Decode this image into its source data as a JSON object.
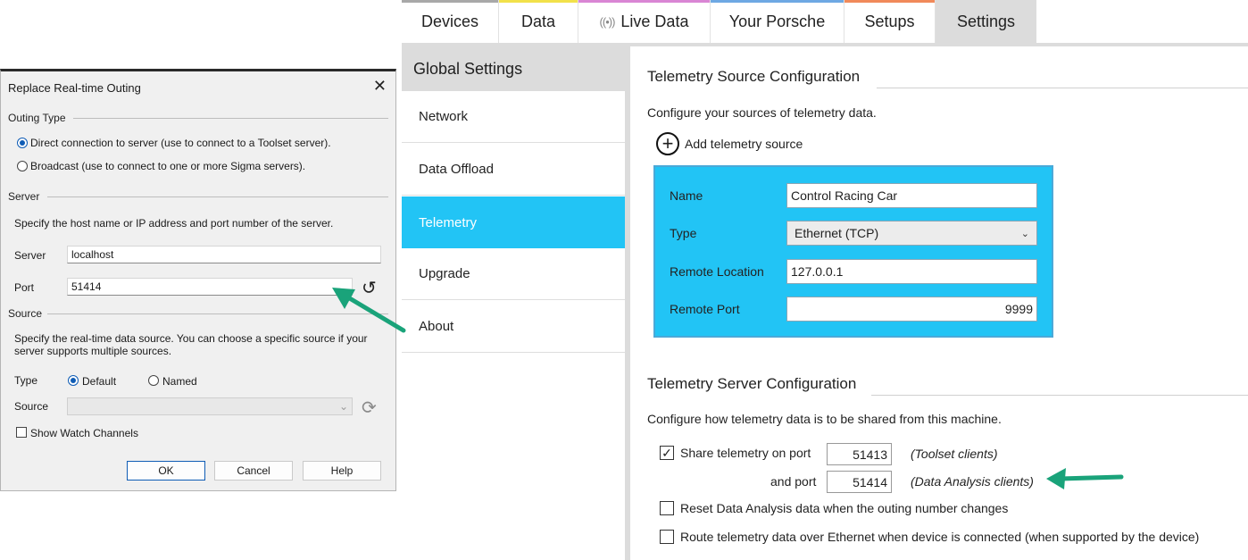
{
  "tabs": [
    {
      "label": "Devices",
      "stripe": "#a8a8a8"
    },
    {
      "label": "Data",
      "stripe": "#f2e14a"
    },
    {
      "label": "Live Data",
      "stripe": "#d986d4",
      "icon": "broadcast-icon",
      "icon_glyph": "((•))"
    },
    {
      "label": "Your Porsche",
      "stripe": "#6ea8e3"
    },
    {
      "label": "Setups",
      "stripe": "#f18a5a"
    },
    {
      "label": "Settings",
      "stripe": "#dcdcdc"
    }
  ],
  "nav": {
    "header": "Global Settings",
    "items": [
      "Network",
      "Data Offload",
      "Telemetry",
      "Upgrade",
      "About"
    ],
    "active_index": 2
  },
  "source_config": {
    "title": "Telemetry Source Configuration",
    "description": "Configure your sources of telemetry data.",
    "add_label": "Add telemetry source",
    "fields": {
      "name_label": "Name",
      "name_value": "Control Racing Car",
      "type_label": "Type",
      "type_value": "Ethernet (TCP)",
      "remote_location_label": "Remote Location",
      "remote_location_value": "127.0.0.1",
      "remote_port_label": "Remote Port",
      "remote_port_value": "9999"
    }
  },
  "server_config": {
    "title": "Telemetry Server Configuration",
    "description": "Configure how telemetry data is to be shared from this machine.",
    "share_label": "Share telemetry on port",
    "share_checked": true,
    "port1": "51413",
    "port1_note": "(Toolset clients)",
    "and_port_label": "and port",
    "port2": "51414",
    "port2_note": "(Data Analysis clients)",
    "reset_label": "Reset Data Analysis data when the outing number changes",
    "reset_checked": false,
    "route_label": "Route telemetry data over Ethernet when device is connected (when supported by the device)",
    "route_checked": false
  },
  "dialog": {
    "title": "Replace Real-time Outing",
    "outing_type_group": "Outing Type",
    "radio_direct": "Direct connection to server (use to connect to a Toolset server).",
    "radio_broadcast": "Broadcast (use to connect to one or more Sigma servers).",
    "selected_outing_type": "direct",
    "server_group": "Server",
    "server_desc": "Specify the host name or IP address and port number of the server.",
    "server_label": "Server",
    "server_value": "localhost",
    "port_label": "Port",
    "port_value": "51414",
    "source_group": "Source",
    "source_desc_line1": "Specify the real-time data source. You can choose a specific source if your",
    "source_desc_line2": "server supports multiple sources.",
    "type_label": "Type",
    "type_default": "Default",
    "type_named": "Named",
    "selected_type": "default",
    "source_label": "Source",
    "source_value": "",
    "show_watch_label": "Show Watch Channels",
    "show_watch_checked": false,
    "ok_label": "OK",
    "cancel_label": "Cancel",
    "help_label": "Help"
  },
  "colors": {
    "accent_blue": "#22c4f5",
    "arrow_green": "#1aa37a"
  }
}
